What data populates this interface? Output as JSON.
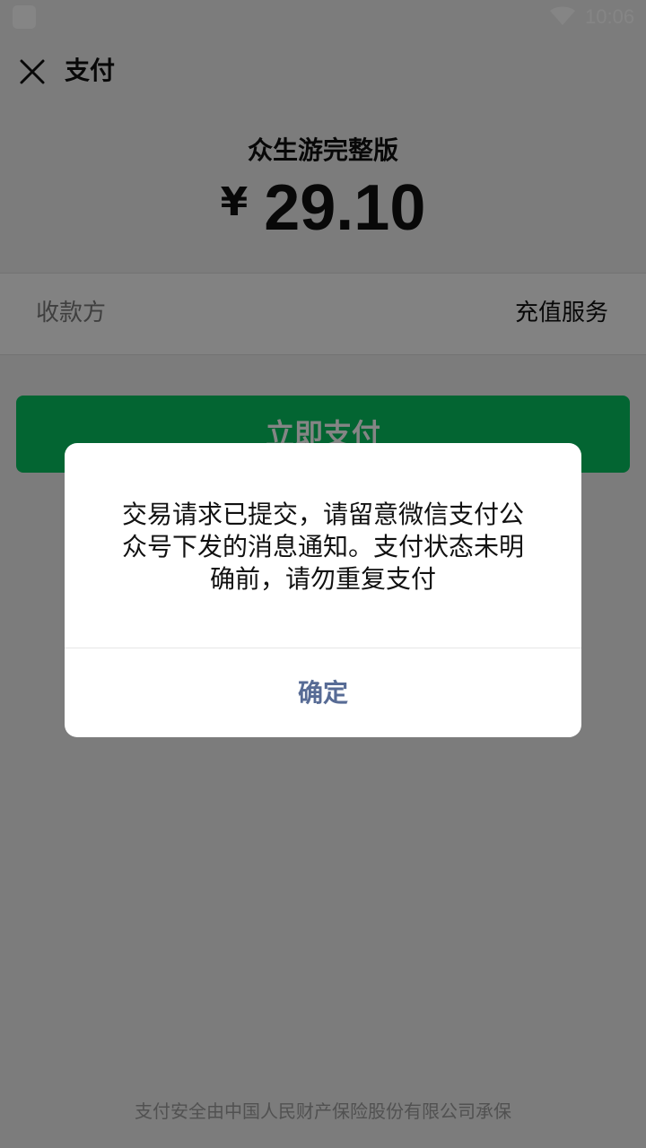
{
  "status_bar": {
    "time": "10:06",
    "wifi_icon": "wifi-icon",
    "app_icon": "app-notification-icon"
  },
  "header": {
    "title": "支付",
    "close_icon": "close-icon"
  },
  "payment": {
    "product_name": "众生游完整版",
    "currency_symbol": "¥",
    "amount": "29.10",
    "payee_label": "收款方",
    "payee_value": "充值服务",
    "pay_button_label": "立即支付"
  },
  "footer": {
    "text": "支付安全由中国人民财产保险股份有限公司承保"
  },
  "dialog": {
    "message_lines": [
      "交易请求已提交，请留意微信支付公",
      "众号下发的消息通知。支付状态未明",
      "确前，请勿重复支付"
    ],
    "confirm_label": "确定"
  },
  "colors": {
    "pay_button": "#07c160",
    "dialog_confirm": "#576b95",
    "background": "#ededed"
  }
}
